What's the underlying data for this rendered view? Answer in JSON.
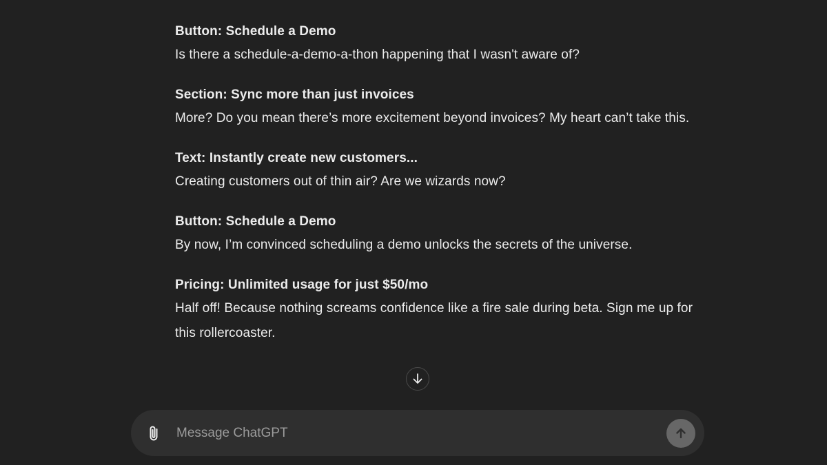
{
  "conversation": {
    "blocks": [
      {
        "title": "Button: Schedule a Demo",
        "body": "Is there a schedule-a-demo-a-thon happening that I wasn't aware of?"
      },
      {
        "title": "Section: Sync more than just invoices",
        "body": "More? Do you mean there’s more excitement beyond invoices? My heart can’t take this."
      },
      {
        "title": "Text: Instantly create new customers...",
        "body": "Creating customers out of thin air? Are we wizards now?"
      },
      {
        "title": "Button: Schedule a Demo",
        "body": "By now, I’m convinced scheduling a demo unlocks the secrets of the universe."
      },
      {
        "title": "Pricing: Unlimited usage for just $50/mo",
        "body": "Half off! Because nothing screams confidence like a fire sale during beta. Sign me up for this rollercoaster."
      }
    ]
  },
  "composer": {
    "placeholder": "Message ChatGPT",
    "attach_icon": "paperclip-icon",
    "send_icon": "arrow-up-icon"
  },
  "scroll": {
    "icon": "arrow-down-icon"
  },
  "colors": {
    "background": "#212121",
    "composer_bg": "#2f2f2f",
    "text": "#ececec",
    "placeholder": "#9b9b9b",
    "send_button": "#676767"
  }
}
